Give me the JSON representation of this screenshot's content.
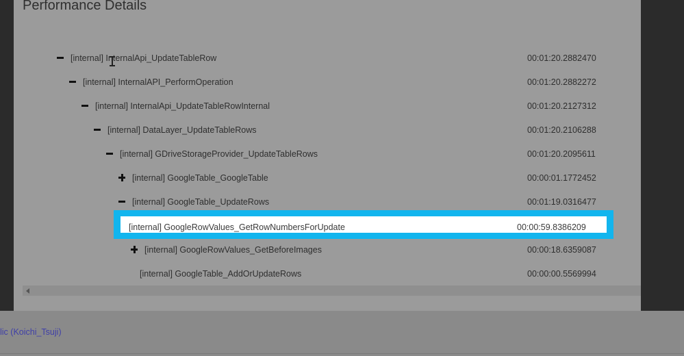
{
  "dialog": {
    "title": "Performance Details",
    "rows": [
      {
        "toggle": "minus",
        "label": "[internal] InternalApi_UpdateTableRow",
        "time": "00:01:20.2882470"
      },
      {
        "toggle": "minus",
        "label": "[internal] InternalAPI_PerformOperation",
        "time": "00:01:20.2882272"
      },
      {
        "toggle": "minus",
        "label": "[internal] InternalApi_UpdateTableRowInternal",
        "time": "00:01:20.2127312"
      },
      {
        "toggle": "minus",
        "label": "[internal] DataLayer_UpdateTableRows",
        "time": "00:01:20.2106288"
      },
      {
        "toggle": "minus",
        "label": "[internal] GDriveStorageProvider_UpdateTableRows",
        "time": "00:01:20.2095611"
      },
      {
        "toggle": "plus",
        "label": "[internal] GoogleTable_GoogleTable",
        "time": "00:00:01.1772452"
      },
      {
        "toggle": "minus",
        "label": "[internal] GoogleTable_UpdateRows",
        "time": "00:01:19.0316477"
      },
      {
        "toggle": "none",
        "label": "[internal] GoogleRowValues_GetRowNumbersForUpdate",
        "time": "00:00:59.8386209",
        "highlighted": true
      },
      {
        "toggle": "plus",
        "label": "[internal] GoogleRowValues_GetBeforeImages",
        "time": "00:00:18.6359087"
      },
      {
        "toggle": "none",
        "label": "[internal] GoogleTable_AddOrUpdateRows",
        "time": "00:00:00.5569994"
      }
    ]
  },
  "footer": {
    "link_text": "lic (Koichi_Tsuji)"
  },
  "colors": {
    "highlight_border": "#12b5ee",
    "link": "#3f3fa8"
  }
}
